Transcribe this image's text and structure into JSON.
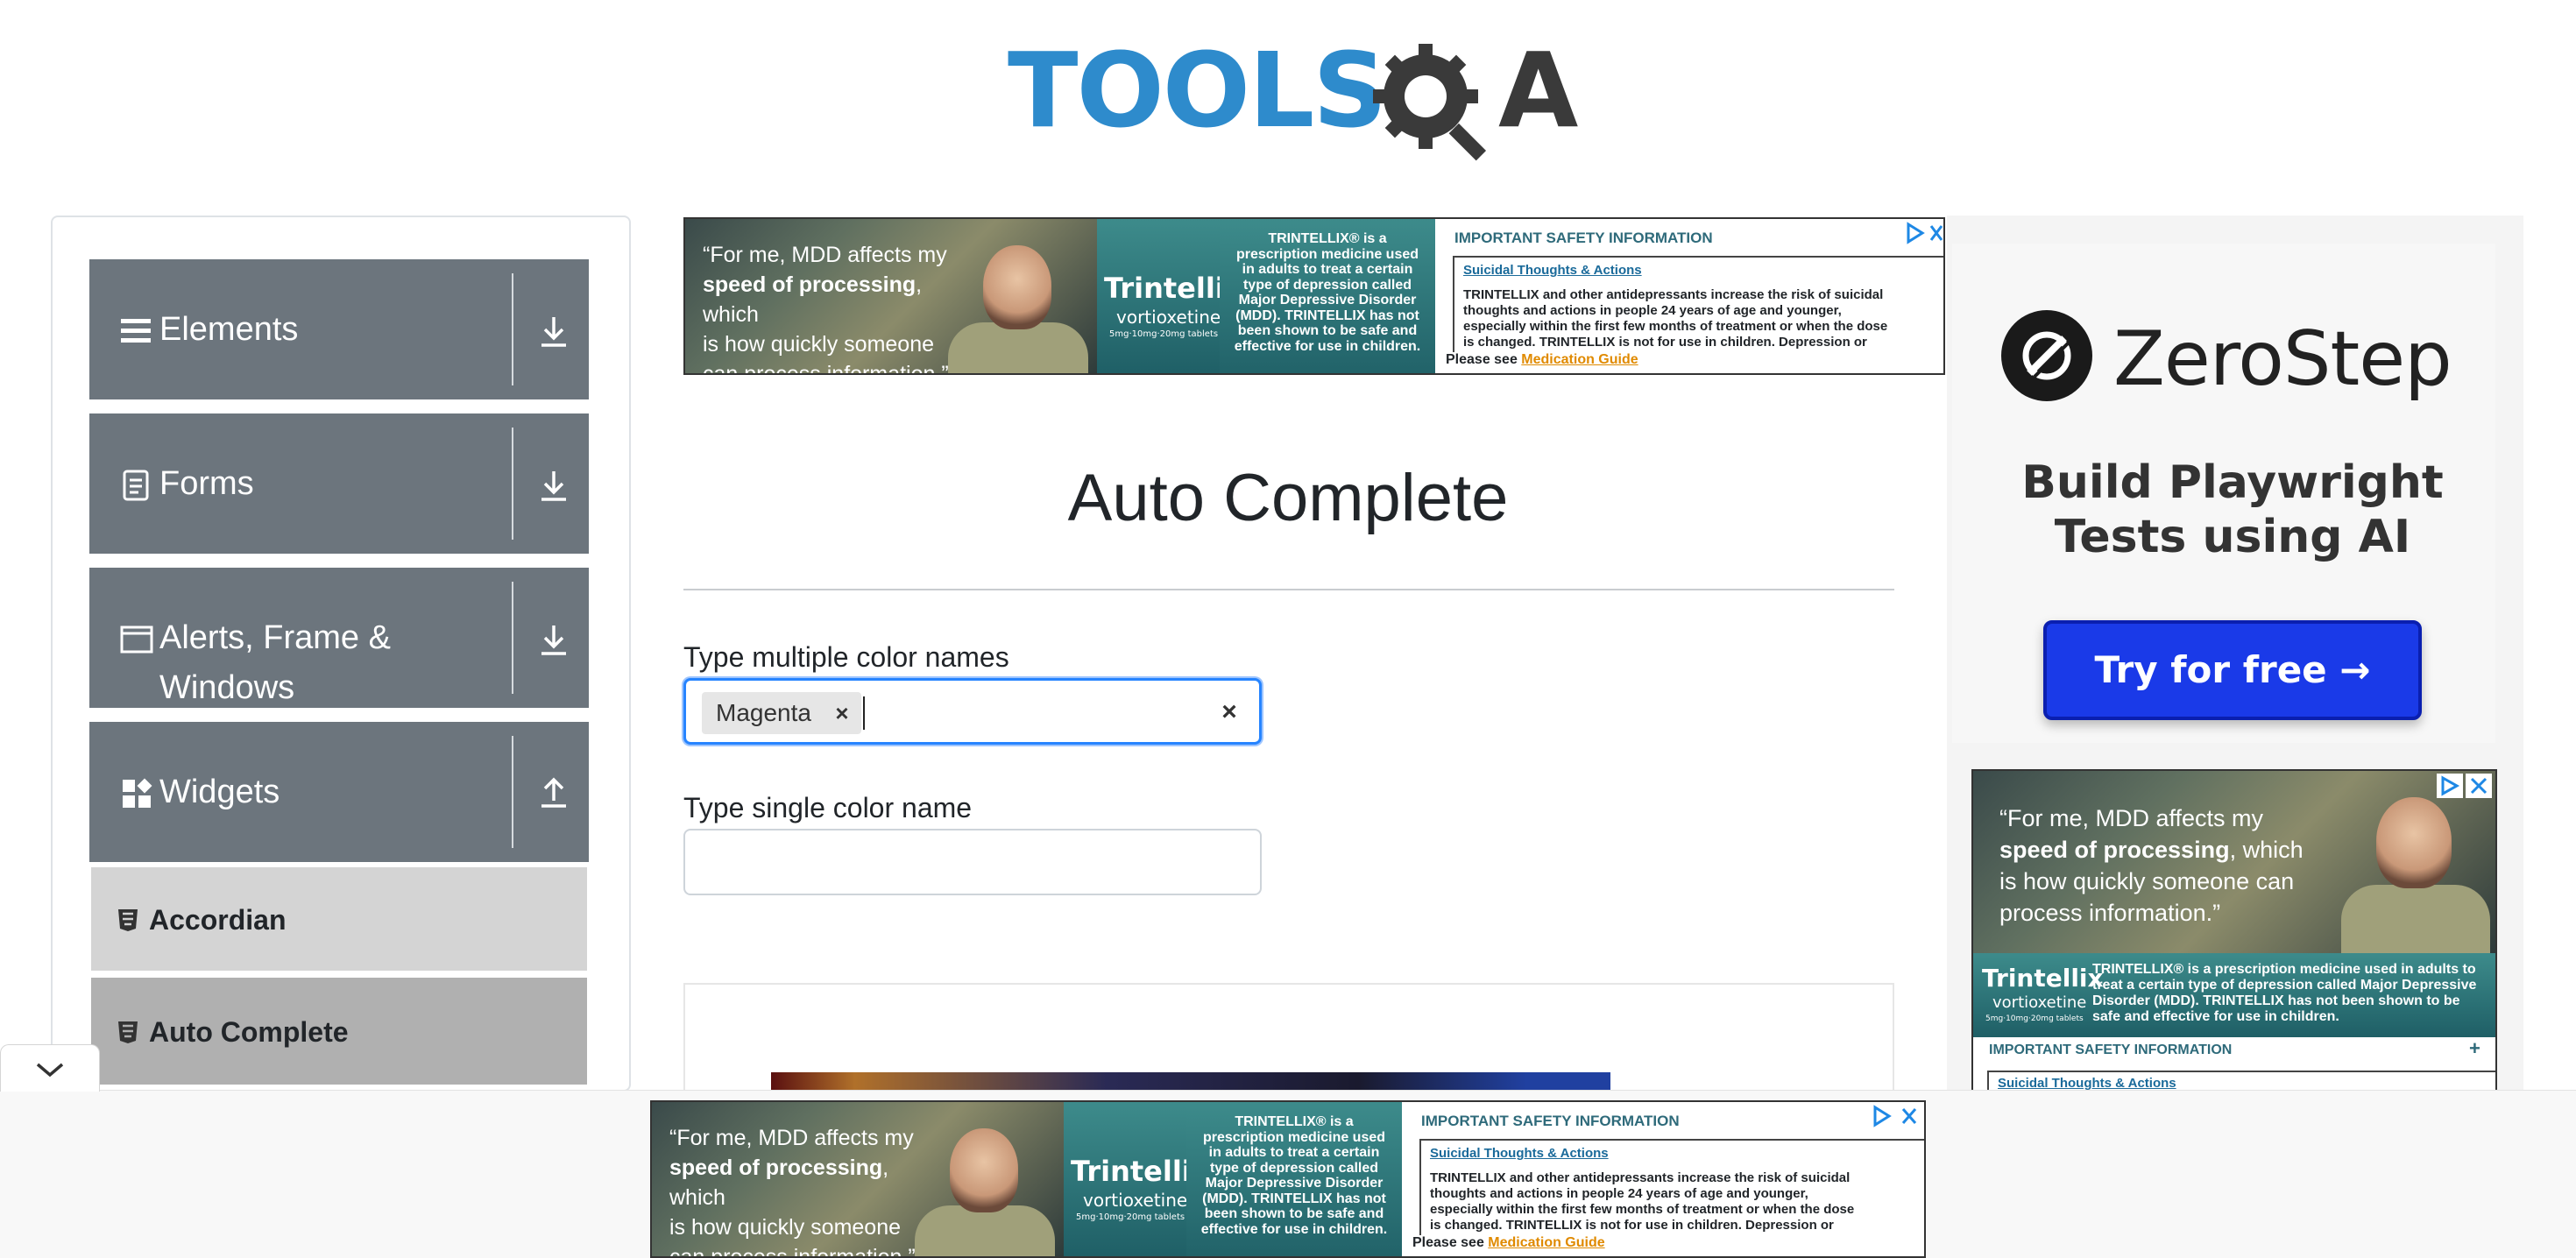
{
  "header": {
    "logo_text_main": "TOOLS",
    "logo_text_end": "A"
  },
  "sidebar": {
    "groups": [
      {
        "label": "Elements"
      },
      {
        "label": "Forms"
      },
      {
        "label": "Alerts, Frame &",
        "label2": "Windows"
      },
      {
        "label": "Widgets"
      }
    ],
    "items": [
      {
        "label": "Accordian"
      },
      {
        "label": "Auto Complete"
      }
    ]
  },
  "top_ad": {
    "quote_line1": "“For me, MDD affects my",
    "quote_line2_bold": "speed of processing",
    "quote_line2_rest": ", which",
    "quote_line3": "is how quickly someone",
    "quote_line4": "can process information.”",
    "brand": "Trintellix",
    "generic": "vortioxetine",
    "dosage": "5mg·10mg·20mg tablets",
    "desc_1": "TRINTELLIX® is a",
    "desc_2": "prescription medicine used",
    "desc_3": "in adults to treat a certain",
    "desc_4": "type of depression called",
    "desc_5": "Major Depressive Disorder",
    "desc_6": "(MDD). TRINTELLIX has not",
    "desc_7": "been shown to be safe and",
    "desc_8": "effective for use in children.",
    "isi_title": "IMPORTANT SAFETY INFORMATION",
    "isi_link": "Suicidal Thoughts & Actions",
    "isi_text_1": "TRINTELLIX and other antidepressants increase the risk of suicidal",
    "isi_text_2": "thoughts and actions in people 24 years of age and younger,",
    "isi_text_3": "especially within the first few months of treatment or when the dose",
    "isi_text_4": "is changed. TRINTELLIX is not for use in children. Depression or",
    "please_see": "Please see ",
    "med_guide": "Medication Guide"
  },
  "main": {
    "title": "Auto Complete",
    "multi_label": "Type multiple color names",
    "multi_chip": "Magenta",
    "chip_remove": "×",
    "clear_all": "×",
    "single_label": "Type single color name",
    "single_value": ""
  },
  "right_ad": {
    "zs_name": "ZeroStep",
    "zs_head_1": "Build Playwright",
    "zs_head_2": "Tests using AI",
    "zs_button": "Try for free →",
    "ad2_quote_line1": "“For me, MDD affects my",
    "ad2_quote_line2_bold": "speed of processing",
    "ad2_quote_line2_rest": ", which",
    "ad2_quote_line3": "is how quickly someone can",
    "ad2_quote_line4": "process information.”",
    "ad2_brand": "Trintellix",
    "ad2_generic": "vortioxetine",
    "ad2_dosage": "5mg·10mg·20mg tablets",
    "ad2_desc_1": "TRINTELLIX® is a prescription medicine used in adults to",
    "ad2_desc_2": "treat a certain type of depression called Major Depressive",
    "ad2_desc_3": "Disorder (MDD). TRINTELLIX has not been shown to be",
    "ad2_desc_4": "safe and effective for use in children.",
    "ad2_isi_title": "IMPORTANT SAFETY INFORMATION",
    "ad2_isi_link": "Suicidal Thoughts & Actions"
  },
  "colors": {
    "sidebar_group_bg": "#6c757d",
    "item_bg": "#d4d4d4",
    "active_item_bg": "#b0b0b0",
    "focus_border": "#2684ff",
    "zs_button": "#1a3ae8",
    "logo_blue": "#2e8bcc"
  }
}
